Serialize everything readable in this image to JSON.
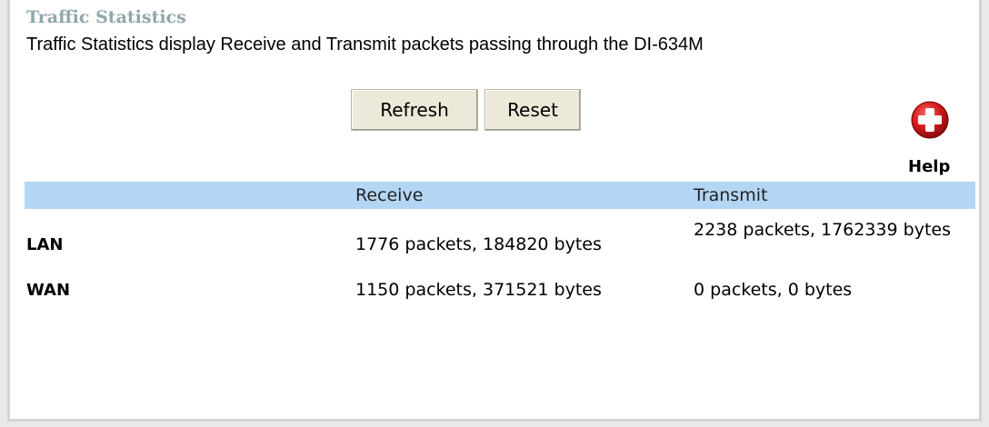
{
  "page": {
    "title": "Traffic Statistics",
    "description": "Traffic Statistics display Receive and Transmit packets passing through the DI-634M"
  },
  "buttons": {
    "refresh_label": "Refresh",
    "reset_label": "Reset"
  },
  "help": {
    "label": "Help",
    "icon": "help-plus-icon",
    "icon_color": "#d11a1a"
  },
  "table": {
    "header_color": "#b4d6f5",
    "columns": [
      "",
      "Receive",
      "Transmit"
    ],
    "rows": [
      {
        "label": "LAN",
        "receive": "1776 packets, 184820 bytes",
        "transmit": "2238 packets, 1762339 bytes"
      },
      {
        "label": "WAN",
        "receive": "1150 packets, 371521 bytes",
        "transmit": "0 packets, 0 bytes"
      }
    ]
  },
  "colors": {
    "title": "#8fa7aa",
    "background": "#ffffff",
    "button_face": "#ece9d8"
  }
}
